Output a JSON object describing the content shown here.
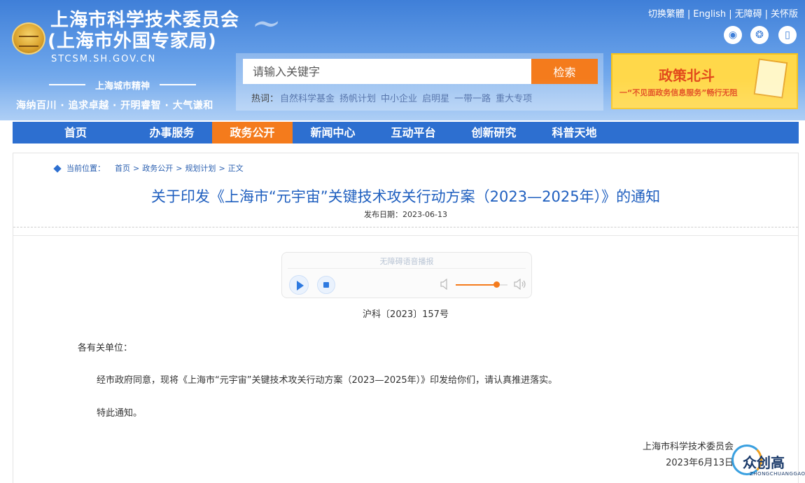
{
  "header": {
    "title": "上海市科学技术委员会",
    "subtitle": "(上海市外国专家局)",
    "domain": "STCSM.SH.GOV.CN",
    "motto_heading": "上海城市精神",
    "motto": "海纳百川 · 追求卓越 · 开明睿智 · 大气谦和",
    "top_links": [
      "切换繁體",
      "English",
      "无障碍",
      "关怀版"
    ],
    "social_icons": [
      "weibo-icon",
      "wechat-icon",
      "mobile-icon"
    ]
  },
  "search": {
    "placeholder": "请输入关键字",
    "button": "检索",
    "hot_label": "热词：",
    "hot_words": [
      "自然科学基金",
      "扬帆计划",
      "中小企业",
      "启明星",
      "一带一路",
      "重大专项"
    ]
  },
  "banner": {
    "title": "政策北斗",
    "subtitle": "一“不见面政务信息服务”畅行无阻"
  },
  "nav": {
    "items": [
      "首页",
      "办事服务",
      "政务公开",
      "新闻中心",
      "互动平台",
      "创新研究",
      "科普天地"
    ],
    "active": "政务公开"
  },
  "breadcrumb": {
    "label": "当前位置：",
    "items": [
      "首页",
      "政务公开",
      "规划计划",
      "正文"
    ]
  },
  "article": {
    "title": "关于印发《上海市“元宇宙”关键技术攻关行动方案（2023—2025年）》的通知",
    "date_label": "发布日期：",
    "date": "2023-06-13",
    "doc_number": "沪科〔2023〕157号",
    "salutation": "各有关单位：",
    "paragraphs": [
      "经市政府同意，现将《上海市“元宇宙”关键技术攻关行动方案（2023—2025年）》印发给你们，请认真推进落实。",
      "特此通知。"
    ],
    "signer": "上海市科学技术委员会",
    "sign_date": "2023年6月13日"
  },
  "player": {
    "label": "无障碍语音播报",
    "volume": 0.78
  },
  "watermark": {
    "text": "众创高",
    "sub": "ZHONGCHUANGGAO"
  },
  "colors": {
    "header_blue": "#3f7fd8",
    "nav_blue": "#2d6fd0",
    "accent_orange": "#f47b1c",
    "title_blue": "#1f5fbf"
  }
}
